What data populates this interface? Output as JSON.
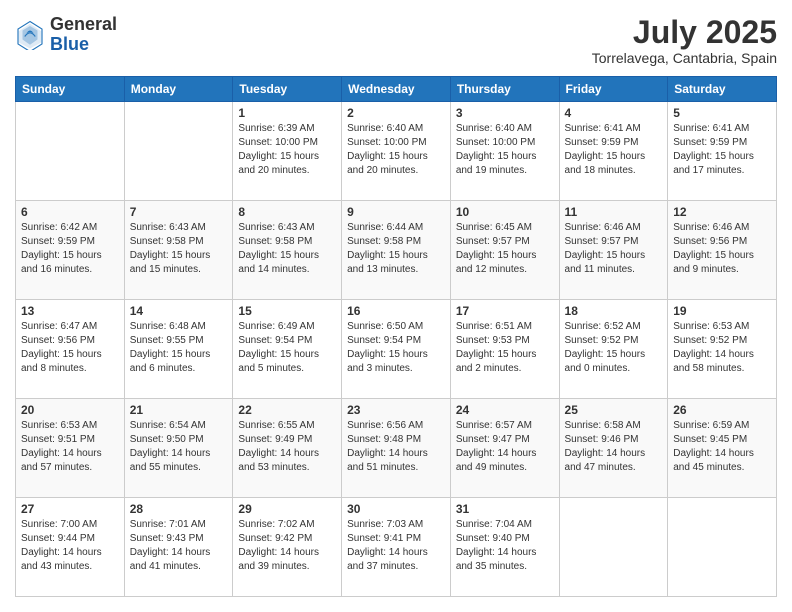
{
  "header": {
    "logo_general": "General",
    "logo_blue": "Blue",
    "month_year": "July 2025",
    "location": "Torrelavega, Cantabria, Spain"
  },
  "weekdays": [
    "Sunday",
    "Monday",
    "Tuesday",
    "Wednesday",
    "Thursday",
    "Friday",
    "Saturday"
  ],
  "weeks": [
    [
      {
        "day": "",
        "info": ""
      },
      {
        "day": "",
        "info": ""
      },
      {
        "day": "1",
        "info": "Sunrise: 6:39 AM\nSunset: 10:00 PM\nDaylight: 15 hours\nand 20 minutes."
      },
      {
        "day": "2",
        "info": "Sunrise: 6:40 AM\nSunset: 10:00 PM\nDaylight: 15 hours\nand 20 minutes."
      },
      {
        "day": "3",
        "info": "Sunrise: 6:40 AM\nSunset: 10:00 PM\nDaylight: 15 hours\nand 19 minutes."
      },
      {
        "day": "4",
        "info": "Sunrise: 6:41 AM\nSunset: 9:59 PM\nDaylight: 15 hours\nand 18 minutes."
      },
      {
        "day": "5",
        "info": "Sunrise: 6:41 AM\nSunset: 9:59 PM\nDaylight: 15 hours\nand 17 minutes."
      }
    ],
    [
      {
        "day": "6",
        "info": "Sunrise: 6:42 AM\nSunset: 9:59 PM\nDaylight: 15 hours\nand 16 minutes."
      },
      {
        "day": "7",
        "info": "Sunrise: 6:43 AM\nSunset: 9:58 PM\nDaylight: 15 hours\nand 15 minutes."
      },
      {
        "day": "8",
        "info": "Sunrise: 6:43 AM\nSunset: 9:58 PM\nDaylight: 15 hours\nand 14 minutes."
      },
      {
        "day": "9",
        "info": "Sunrise: 6:44 AM\nSunset: 9:58 PM\nDaylight: 15 hours\nand 13 minutes."
      },
      {
        "day": "10",
        "info": "Sunrise: 6:45 AM\nSunset: 9:57 PM\nDaylight: 15 hours\nand 12 minutes."
      },
      {
        "day": "11",
        "info": "Sunrise: 6:46 AM\nSunset: 9:57 PM\nDaylight: 15 hours\nand 11 minutes."
      },
      {
        "day": "12",
        "info": "Sunrise: 6:46 AM\nSunset: 9:56 PM\nDaylight: 15 hours\nand 9 minutes."
      }
    ],
    [
      {
        "day": "13",
        "info": "Sunrise: 6:47 AM\nSunset: 9:56 PM\nDaylight: 15 hours\nand 8 minutes."
      },
      {
        "day": "14",
        "info": "Sunrise: 6:48 AM\nSunset: 9:55 PM\nDaylight: 15 hours\nand 6 minutes."
      },
      {
        "day": "15",
        "info": "Sunrise: 6:49 AM\nSunset: 9:54 PM\nDaylight: 15 hours\nand 5 minutes."
      },
      {
        "day": "16",
        "info": "Sunrise: 6:50 AM\nSunset: 9:54 PM\nDaylight: 15 hours\nand 3 minutes."
      },
      {
        "day": "17",
        "info": "Sunrise: 6:51 AM\nSunset: 9:53 PM\nDaylight: 15 hours\nand 2 minutes."
      },
      {
        "day": "18",
        "info": "Sunrise: 6:52 AM\nSunset: 9:52 PM\nDaylight: 15 hours\nand 0 minutes."
      },
      {
        "day": "19",
        "info": "Sunrise: 6:53 AM\nSunset: 9:52 PM\nDaylight: 14 hours\nand 58 minutes."
      }
    ],
    [
      {
        "day": "20",
        "info": "Sunrise: 6:53 AM\nSunset: 9:51 PM\nDaylight: 14 hours\nand 57 minutes."
      },
      {
        "day": "21",
        "info": "Sunrise: 6:54 AM\nSunset: 9:50 PM\nDaylight: 14 hours\nand 55 minutes."
      },
      {
        "day": "22",
        "info": "Sunrise: 6:55 AM\nSunset: 9:49 PM\nDaylight: 14 hours\nand 53 minutes."
      },
      {
        "day": "23",
        "info": "Sunrise: 6:56 AM\nSunset: 9:48 PM\nDaylight: 14 hours\nand 51 minutes."
      },
      {
        "day": "24",
        "info": "Sunrise: 6:57 AM\nSunset: 9:47 PM\nDaylight: 14 hours\nand 49 minutes."
      },
      {
        "day": "25",
        "info": "Sunrise: 6:58 AM\nSunset: 9:46 PM\nDaylight: 14 hours\nand 47 minutes."
      },
      {
        "day": "26",
        "info": "Sunrise: 6:59 AM\nSunset: 9:45 PM\nDaylight: 14 hours\nand 45 minutes."
      }
    ],
    [
      {
        "day": "27",
        "info": "Sunrise: 7:00 AM\nSunset: 9:44 PM\nDaylight: 14 hours\nand 43 minutes."
      },
      {
        "day": "28",
        "info": "Sunrise: 7:01 AM\nSunset: 9:43 PM\nDaylight: 14 hours\nand 41 minutes."
      },
      {
        "day": "29",
        "info": "Sunrise: 7:02 AM\nSunset: 9:42 PM\nDaylight: 14 hours\nand 39 minutes."
      },
      {
        "day": "30",
        "info": "Sunrise: 7:03 AM\nSunset: 9:41 PM\nDaylight: 14 hours\nand 37 minutes."
      },
      {
        "day": "31",
        "info": "Sunrise: 7:04 AM\nSunset: 9:40 PM\nDaylight: 14 hours\nand 35 minutes."
      },
      {
        "day": "",
        "info": ""
      },
      {
        "day": "",
        "info": ""
      }
    ]
  ]
}
